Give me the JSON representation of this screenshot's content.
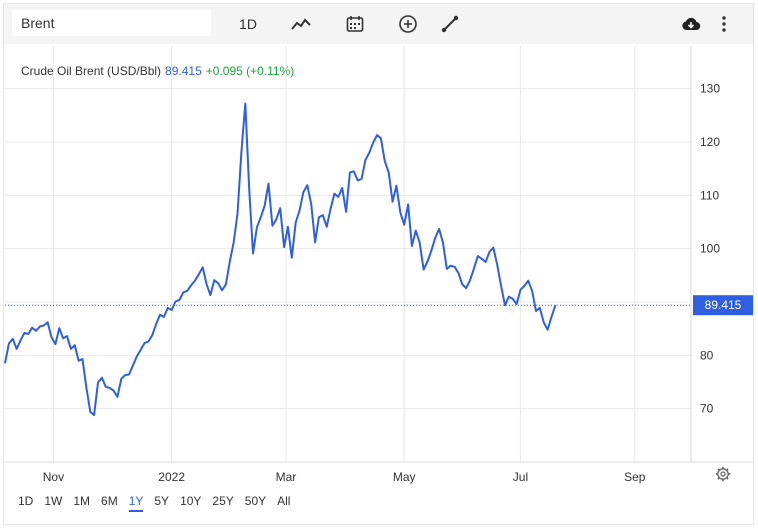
{
  "toolbar": {
    "search_value": "Brent",
    "interval_label": "1D",
    "icons": [
      "line-style-icon",
      "calendar-icon",
      "add-circle-icon",
      "draw-line-icon",
      "cloud-download-icon",
      "more-vertical-icon"
    ]
  },
  "header": {
    "name": "Crude Oil Brent (USD/Bbl)",
    "price": "89.415",
    "change": "+0.095 (+0.11%)"
  },
  "ranges": {
    "items": [
      "1D",
      "1W",
      "1M",
      "6M",
      "1Y",
      "5Y",
      "10Y",
      "25Y",
      "50Y",
      "All"
    ],
    "active": "1Y"
  },
  "colors": {
    "line": "#2f5fe0",
    "change_positive": "#19a33a",
    "price_label_bg": "#2f5fe0",
    "grid": "#e8e8e8"
  },
  "chart_data": {
    "type": "line",
    "title": "Crude Oil Brent (USD/Bbl)",
    "last_value_label": "89.415",
    "y_ticks": [
      70,
      80,
      90,
      100,
      110,
      120,
      130
    ],
    "ylim": [
      60,
      138
    ],
    "x_tick_labels": [
      "Nov",
      "2022",
      "Mar",
      "May",
      "Jul",
      "Sep"
    ],
    "x_tick_positions": [
      25,
      86,
      145,
      206,
      266,
      325
    ],
    "x_range": [
      0,
      354
    ],
    "grid": true,
    "x": [
      0,
      2,
      4,
      6,
      8,
      10,
      12,
      14,
      16,
      18,
      20,
      22,
      24,
      26,
      28,
      30,
      32,
      34,
      36,
      38,
      40,
      42,
      44,
      46,
      48,
      50,
      52,
      54,
      56,
      58,
      60,
      62,
      64,
      66,
      68,
      70,
      72,
      74,
      76,
      78,
      80,
      82,
      84,
      86,
      88,
      90,
      92,
      94,
      96,
      98,
      100,
      102,
      104,
      106,
      108,
      110,
      112,
      114,
      116,
      118,
      120,
      122,
      124,
      126,
      128,
      130,
      132,
      134,
      136,
      138,
      140,
      142,
      144,
      146,
      148,
      150,
      152,
      154,
      156,
      158,
      160,
      162,
      164,
      166,
      168,
      170,
      172,
      174,
      176,
      178,
      180,
      182,
      184,
      186,
      188,
      190,
      192,
      194,
      196,
      198,
      200,
      202,
      204,
      206,
      208,
      210,
      212,
      214,
      216,
      218,
      220,
      222,
      224,
      226,
      228,
      230,
      232,
      234,
      236,
      238,
      240,
      242,
      244,
      246,
      248,
      250,
      252,
      254,
      256,
      258,
      260,
      262,
      264,
      266,
      268,
      270,
      272,
      274,
      276,
      278,
      280,
      282,
      284,
      286,
      288,
      290,
      292,
      294,
      296,
      298,
      300,
      302,
      304,
      306,
      308,
      310,
      312,
      314,
      316,
      318,
      320,
      322,
      324,
      326,
      328,
      330,
      332,
      334,
      336,
      338,
      340,
      342,
      344,
      346,
      348,
      350,
      352,
      354
    ],
    "series": [
      {
        "values": [
          78.5,
          82.2,
          83.1,
          81.2,
          82.8,
          84.2,
          84.0,
          85.2,
          84.6,
          85.4,
          85.6,
          86.2,
          83.4,
          82.1,
          85.1,
          83.2,
          83.6,
          81.2,
          81.9,
          79.0,
          79.3,
          73.9,
          69.4,
          68.8,
          74.9,
          75.8,
          74.1,
          73.9,
          73.4,
          72.2,
          75.6,
          76.3,
          76.4,
          78.1,
          79.8,
          81.0,
          82.3,
          82.6,
          83.8,
          85.9,
          87.6,
          87.2,
          88.9,
          88.5,
          90.1,
          90.4,
          91.8,
          92.1,
          93.1,
          94.0,
          95.2,
          96.5,
          93.4,
          91.3,
          94.1,
          93.5,
          92.2,
          93.3,
          97.6,
          101.2,
          106.6,
          118.1,
          127.2,
          111.2,
          99.1,
          104.0,
          105.9,
          108.1,
          112.2,
          104.3,
          105.5,
          107.6,
          100.3,
          104.1,
          98.3,
          104.9,
          107.2,
          110.6,
          111.9,
          108.4,
          101.2,
          105.9,
          106.3,
          104.1,
          107.5,
          110.3,
          109.7,
          111.4,
          106.9,
          114.3,
          114.5,
          112.8,
          113.1,
          116.6,
          118.0,
          119.9,
          121.3,
          120.7,
          116.4,
          114.3,
          108.8,
          111.8,
          106.8,
          104.5,
          108.3,
          100.5,
          103.4,
          101.1,
          96.1,
          97.6,
          99.6,
          102.0,
          103.7,
          101.1,
          96.2,
          96.8,
          96.6,
          95.4,
          93.3,
          92.6,
          94.1,
          96.3,
          98.6,
          98.1,
          97.5,
          99.4,
          100.2,
          97.0,
          93.0,
          89.4,
          91.0,
          90.6,
          89.6,
          92.3,
          93.0,
          94.0,
          92.1,
          88.3,
          88.9,
          86.2,
          84.8,
          87.2,
          89.4
        ],
        "note_count": 0
      }
    ]
  }
}
